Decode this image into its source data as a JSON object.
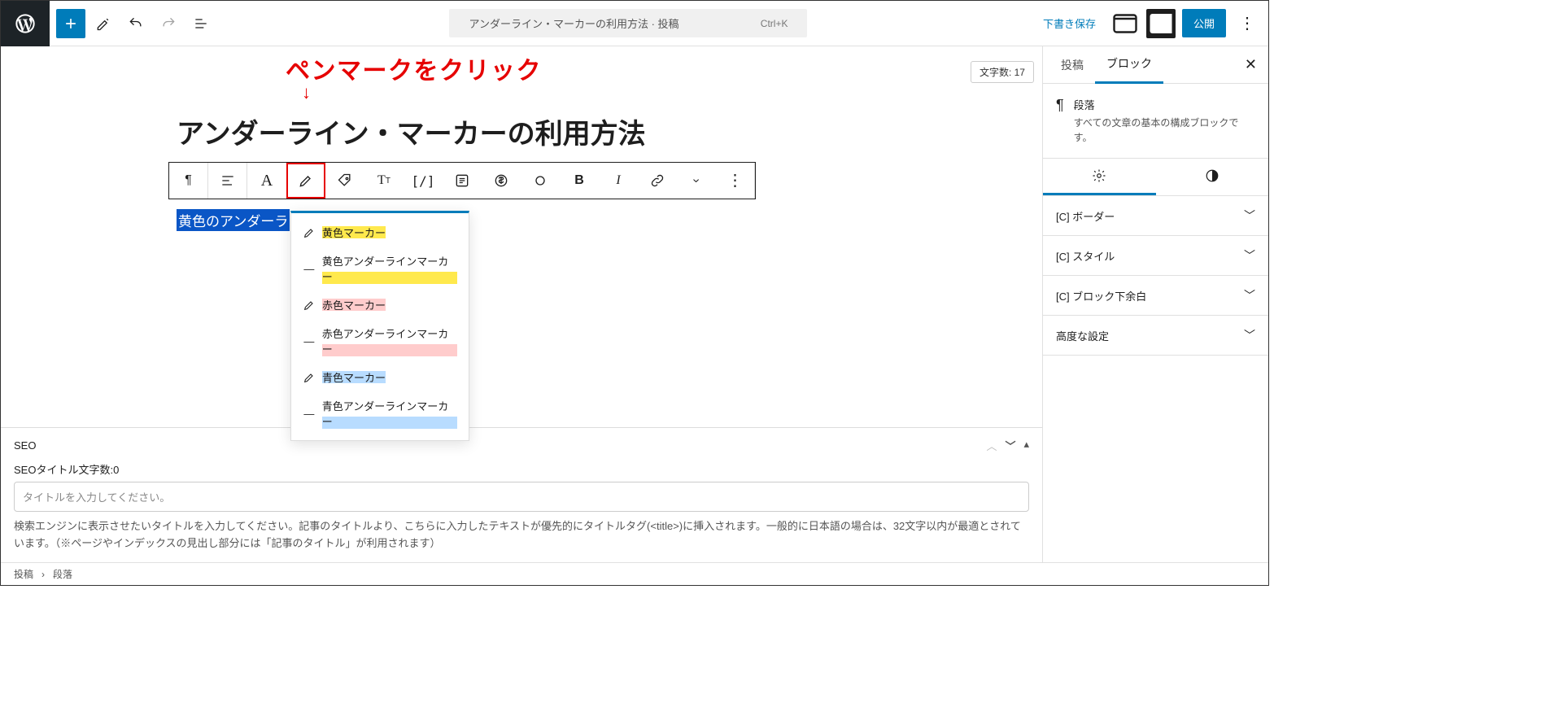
{
  "topbar": {
    "doc_title": "アンダーライン・マーカーの利用方法 · 投稿",
    "shortcut": "Ctrl+K",
    "save_draft": "下書き保存",
    "publish": "公開"
  },
  "annotation": "ペンマークをクリック",
  "word_count": "文字数: 17",
  "post_title": "アンダーライン・マーカーの利用方法",
  "selected_text": "黄色のアンダーラ",
  "dropdown": {
    "items": [
      {
        "label": "黄色マーカー",
        "style": "mark-y",
        "icon": "pen"
      },
      {
        "label": "黄色アンダーラインマーカー",
        "style": "ul-y",
        "icon": "line"
      },
      {
        "label": "赤色マーカー",
        "style": "mark-r",
        "icon": "pen"
      },
      {
        "label": "赤色アンダーラインマーカー",
        "style": "ul-r",
        "icon": "line"
      },
      {
        "label": "青色マーカー",
        "style": "mark-b",
        "icon": "pen"
      },
      {
        "label": "青色アンダーラインマーカー",
        "style": "ul-b",
        "icon": "line"
      }
    ]
  },
  "seo": {
    "heading": "SEO",
    "count_label": "SEOタイトル文字数:0",
    "placeholder": "タイトルを入力してください。",
    "help": "検索エンジンに表示させたいタイトルを入力してください。記事のタイトルより、こちらに入力したテキストが優先的にタイトルタグ(<title>)に挿入されます。一般的に日本語の場合は、32文字以内が最適とされています。（※ページやインデックスの見出し部分には「記事のタイトル」が利用されます）"
  },
  "sidebar": {
    "tabs": {
      "post": "投稿",
      "block": "ブロック"
    },
    "block": {
      "name": "段落",
      "desc": "すべての文章の基本の構成ブロックです。"
    },
    "sections": {
      "border": "[C] ボーダー",
      "style": "[C] スタイル",
      "margin": "[C] ブロック下余白",
      "advanced": "高度な設定"
    }
  },
  "breadcrumb": {
    "a": "投稿",
    "b": "段落"
  }
}
